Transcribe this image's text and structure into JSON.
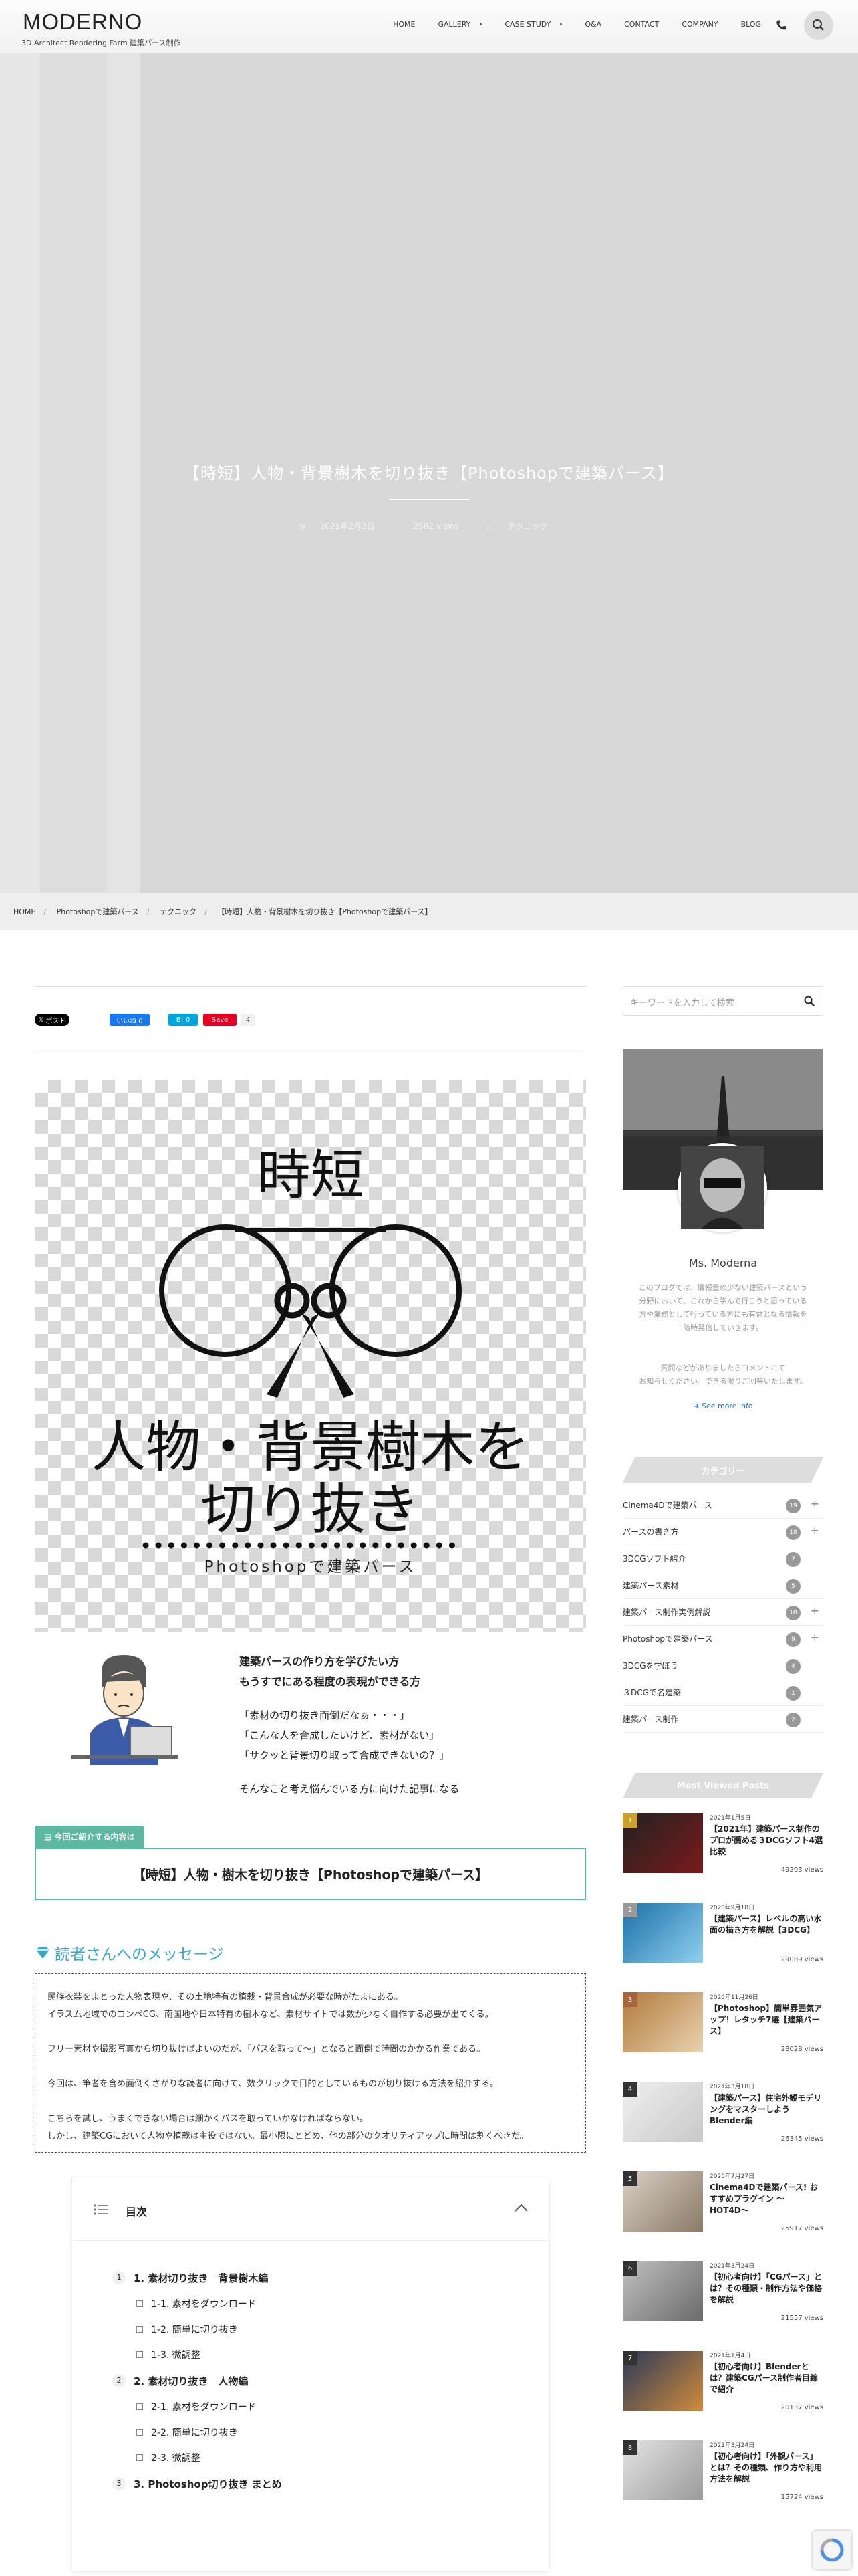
{
  "header": {
    "logo": "MODERNO",
    "logo_sub": "3D Architect Rendering Farm 建築パース制作",
    "nav": [
      "HOME",
      "GALLERY",
      "CASE STUDY",
      "Q&A",
      "CONTACT",
      "COMPANY",
      "BLOG"
    ]
  },
  "hero": {
    "title": "【時短】人物・背景樹木を切り抜き【Photoshopで建築パース】",
    "date": "2021年2月2日",
    "views": "2582 views",
    "category": "テクニック"
  },
  "breadcrumb": [
    "HOME",
    "Photoshopで建築パース",
    "テクニック",
    "【時短】人物・背景樹木を切り抜き【Photoshopで建築パース】"
  ],
  "share": {
    "tweet": "ポスト",
    "like": "いいね 0",
    "hatena": "B! 0",
    "pin": "Save",
    "pin_count": "4"
  },
  "eyecatch": {
    "top": "時短",
    "line1": "人物・背景樹木を",
    "line2": "切り抜き",
    "sub": "Photoshopで建築パース"
  },
  "intro": {
    "lead1": "建築パースの作り方を学びたい方",
    "lead2": "もうすでにある程度の表現ができる方",
    "q1": "「素材の切り抜き面倒だなぁ・・・」",
    "q2": "「こんな人を合成したいけど、素材がない」",
    "q3": "「サクッと背景切り取って合成できないの？」",
    "closing": "そんなこと考え悩んでいる方に向けた記事になる"
  },
  "box": {
    "label": "今回ご紹介する内容は",
    "content": "【時短】人物・樹木を切り抜き【Photoshopで建築パース】"
  },
  "message": {
    "heading": "読者さんへのメッセージ",
    "p1": "民族衣装をまとった人物表現や、その土地特有の植栽・背景合成が必要な時がたまにある。",
    "p2": "イラスム地域でのコンペCG、南国地や日本特有の樹木など、素材サイトでは数が少なく自作する必要が出てくる。",
    "p3": "フリー素材や撮影写真から切り抜けばよいのだが、「パスを取って〜」となると面倒で時間のかかる作業である。",
    "p4": "今回は、筆者を含め面倒くさがりな読者に向けて、数クリックで目的としているものが切り抜ける方法を紹介する。",
    "p5": "こちらを試し、うまくできない場合は細かくパスを取っていかなければならない。",
    "p6": "しかし、建築CGにおいて人物や植栽は主役ではない。最小限にとどめ、他の部分のクオリティアップに時間は割くべきだ。"
  },
  "toc": {
    "title": "目次",
    "items": [
      {
        "num": "1",
        "label": "1. 素材切り抜き　背景樹木編"
      },
      {
        "label": "1-1. 素材をダウンロード"
      },
      {
        "label": "1-2. 簡単に切り抜き"
      },
      {
        "label": "1-3. 微調整"
      },
      {
        "num": "2",
        "label": "2. 素材切り抜き　人物編"
      },
      {
        "label": "2-1. 素材をダウンロード"
      },
      {
        "label": "2-2. 簡単に切り抜き"
      },
      {
        "label": "2-3. 微調整"
      },
      {
        "num": "3",
        "label": "3. Photoshop切り抜き まとめ"
      }
    ]
  },
  "sidebar": {
    "search_placeholder": "キーワードを入力して検索",
    "profile_name": "Ms. Moderna",
    "profile_desc1": "このブログでは、情報量の少ない建築パースという",
    "profile_desc2": "分野において、これから学んで行こうと思っている",
    "profile_desc3": "方や業務として行っている方にも有益となる情報を",
    "profile_desc4": "随時発信していきます。",
    "profile_desc5": "質問などがありましたらコメントにて",
    "profile_desc6": "お知らせください。できる限りご回答いたします。",
    "see_more": "See more info",
    "category_head": "カテゴリー",
    "categories": [
      {
        "name": "Cinema4Dで建築パース",
        "count": "19",
        "plus": true
      },
      {
        "name": "パースの書き方",
        "count": "18",
        "plus": true
      },
      {
        "name": "3DCGソフト紹介",
        "count": "7",
        "plus": false
      },
      {
        "name": "建築パース素材",
        "count": "5",
        "plus": false
      },
      {
        "name": "建築パース制作実例解説",
        "count": "10",
        "plus": true
      },
      {
        "name": "Photoshopで建築パース",
        "count": "9",
        "plus": true
      },
      {
        "name": "3DCGを学ぼう",
        "count": "4",
        "plus": false
      },
      {
        "name": "３DCGで名建築",
        "count": "1",
        "plus": false
      },
      {
        "name": "建築パース制作",
        "count": "2",
        "plus": false
      }
    ],
    "posts_head": "Most Viewed Posts",
    "posts": [
      {
        "rank": "1",
        "date": "2021年1月5日",
        "title": "【2021年】建築パース制作のプロが薦める３DCGソフト4選比較",
        "views": "49203 views"
      },
      {
        "rank": "2",
        "date": "2020年9月18日",
        "title": "【建築パース】レベルの高い水面の描き方を解説【3DCG】",
        "views": "29089 views"
      },
      {
        "rank": "3",
        "date": "2020年11月26日",
        "title": "【Photoshop】簡単雰囲気アップ！レタッチ7選【建築パース】",
        "views": "28028 views"
      },
      {
        "rank": "4",
        "date": "2021年3月18日",
        "title": "【建築パース】住宅外観モデリングをマスターしよう Blender編",
        "views": "26345 views"
      },
      {
        "rank": "5",
        "date": "2020年7月27日",
        "title": "Cinema4Dで建築パース! おすすめプラグイン 〜HOT4D〜",
        "views": "25917 views"
      },
      {
        "rank": "6",
        "date": "2021年3月24日",
        "title": "【初心者向け】「CGパース」とは？その種類・制作方法や価格を解説",
        "views": "21557 views"
      },
      {
        "rank": "7",
        "date": "2021年1月4日",
        "title": "【初心者向け】Blenderとは？建築CGパース制作者目線で紹介",
        "views": "20137 views"
      },
      {
        "rank": "8",
        "date": "2021年3月24日",
        "title": "【初心者向け】「外観パース」とは？その種類、作り方や利用方法を解説",
        "views": "15724 views"
      }
    ]
  }
}
